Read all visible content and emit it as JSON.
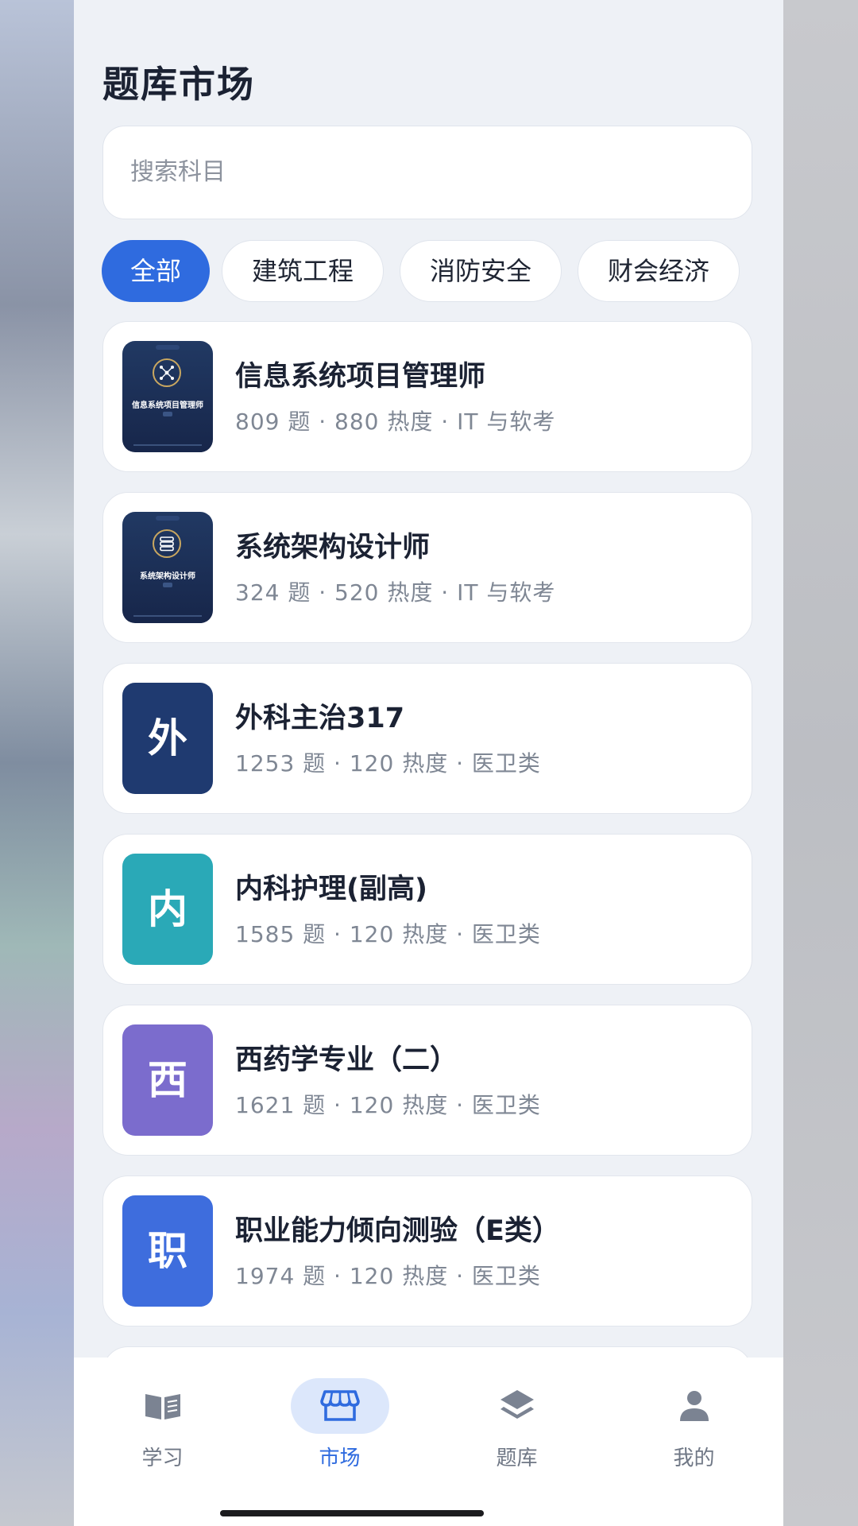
{
  "page": {
    "title": "题库市场"
  },
  "search": {
    "placeholder": "搜索科目"
  },
  "categories": [
    "全部",
    "建筑工程",
    "消防安全",
    "财会经济"
  ],
  "subjects": [
    {
      "title": "信息系统项目管理师",
      "meta": "809 题 · 880 热度 · IT 与软考",
      "thumb_type": "cover",
      "cover_title": "信息系统项目管理师",
      "cover_icon": "network-icon"
    },
    {
      "title": "系统架构设计师",
      "meta": "324 题 · 520 热度 · IT 与软考",
      "thumb_type": "cover",
      "cover_title": "系统架构设计师",
      "cover_icon": "database-icon"
    },
    {
      "title": "外科主治317",
      "meta": "1253 题 · 120 热度 · 医卫类",
      "thumb_type": "letter",
      "letter": "外",
      "color": "#1f3a70"
    },
    {
      "title": "内科护理(副高)",
      "meta": "1585 题 · 120 热度 · 医卫类",
      "thumb_type": "letter",
      "letter": "内",
      "color": "#2aa9b7"
    },
    {
      "title": "西药学专业（二）",
      "meta": "1621 题 · 120 热度 · 医卫类",
      "thumb_type": "letter",
      "letter": "西",
      "color": "#7b6ccd"
    },
    {
      "title": "职业能力倾向测验（E类）",
      "meta": "1974 题 · 120 热度 · 医卫类",
      "thumb_type": "letter",
      "letter": "职",
      "color": "#3e6ddd"
    }
  ],
  "tabs": [
    {
      "label": "学习",
      "icon": "book-icon"
    },
    {
      "label": "市场",
      "icon": "store-icon",
      "active": true
    },
    {
      "label": "题库",
      "icon": "layers-icon"
    },
    {
      "label": "我的",
      "icon": "user-icon"
    }
  ],
  "colors": {
    "accent": "#2f6bdf",
    "background": "#eef1f6"
  }
}
